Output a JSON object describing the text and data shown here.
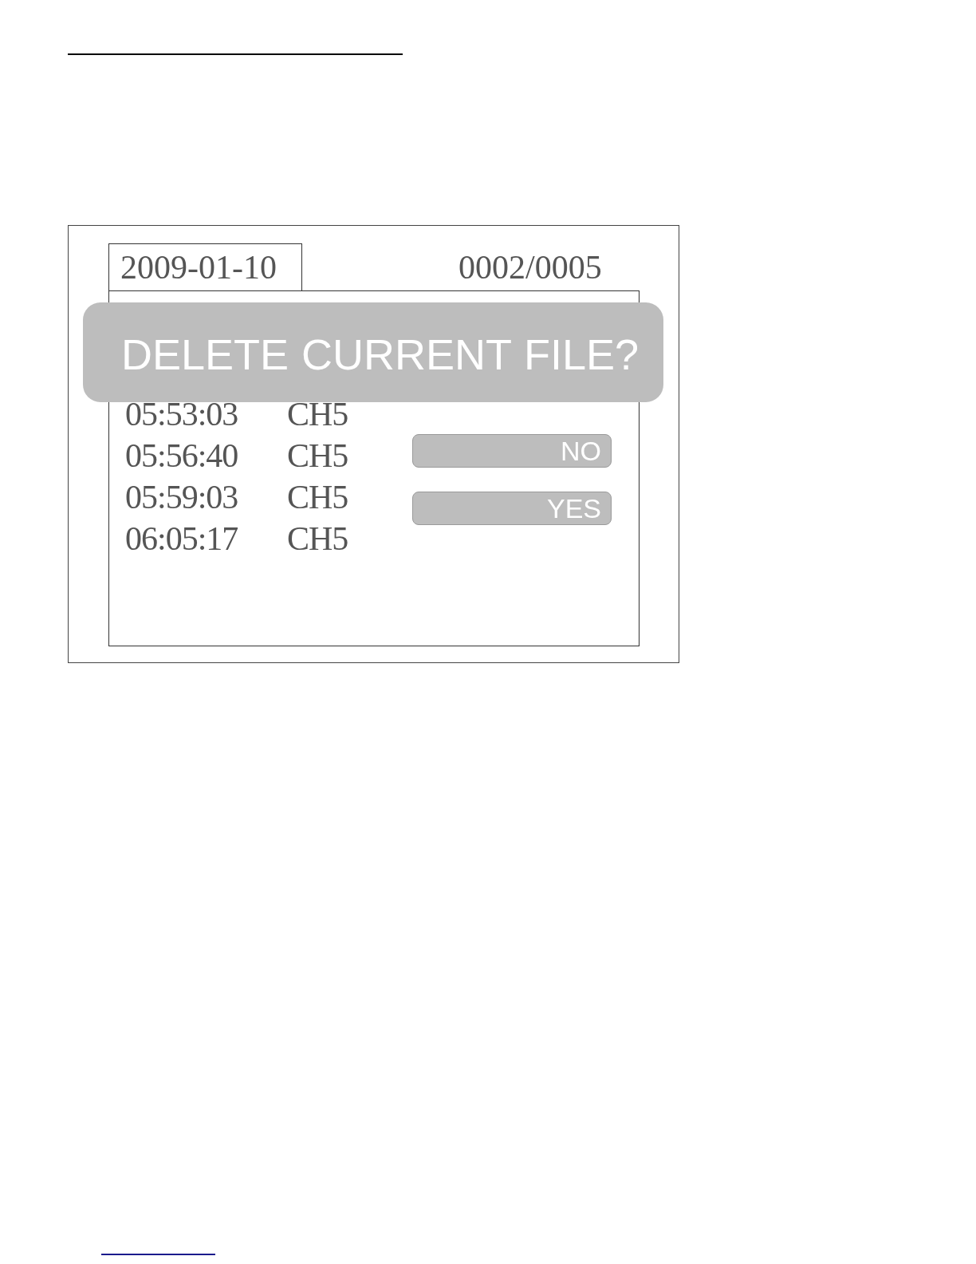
{
  "screen": {
    "date_tab": "2009-01-10",
    "file_counter": "0002/0005",
    "recordings": [
      {
        "time": "05:53:03",
        "channel": "CH5"
      },
      {
        "time": "05:56:40",
        "channel": "CH5"
      },
      {
        "time": "05:59:03",
        "channel": "CH5"
      },
      {
        "time": "06:05:17",
        "channel": "CH5"
      }
    ],
    "dialog": {
      "message": "DELETE CURRENT FILE?",
      "buttons": [
        {
          "label": "NO"
        },
        {
          "label": "YES"
        }
      ]
    }
  }
}
